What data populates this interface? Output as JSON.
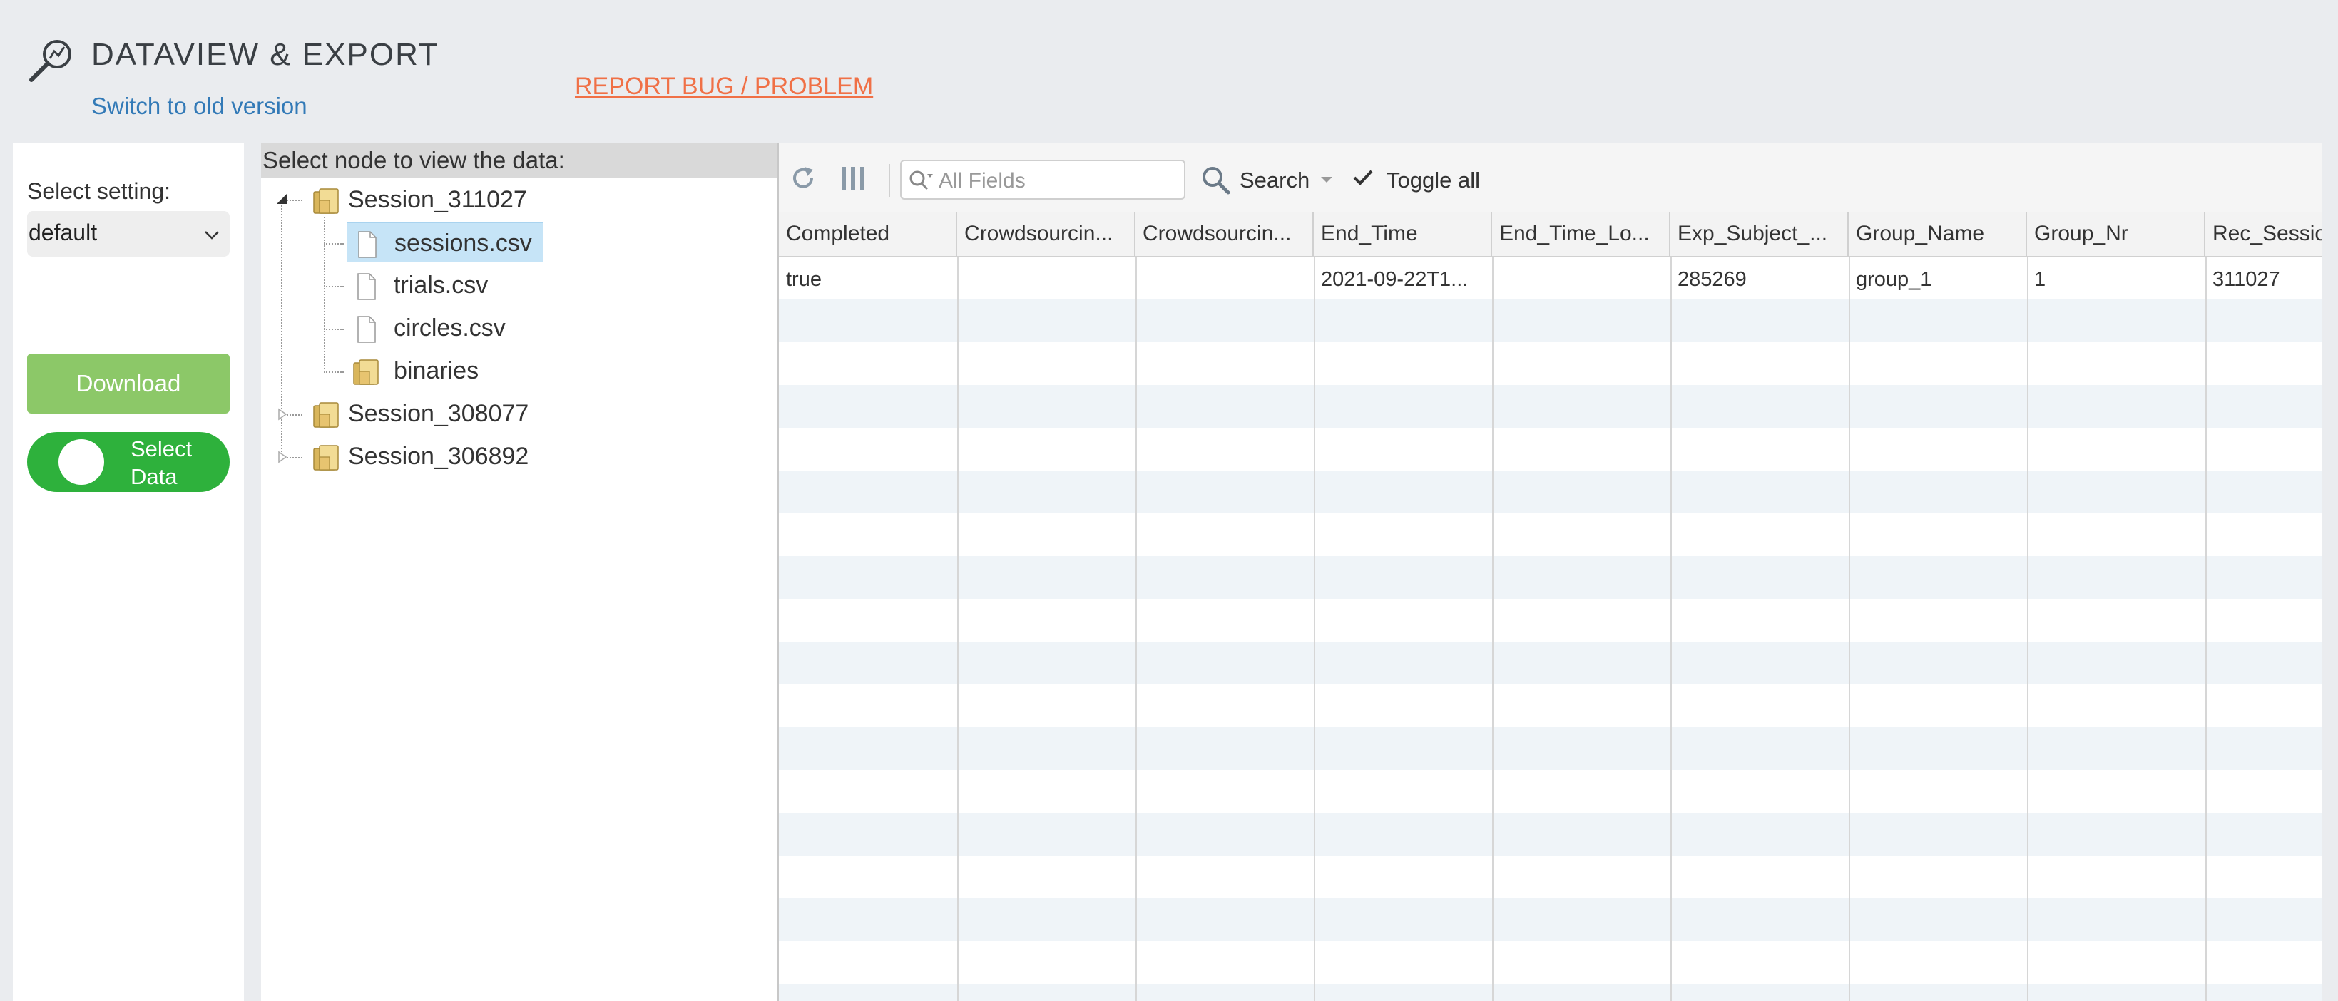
{
  "header": {
    "title": "DATAVIEW & EXPORT",
    "switch_link": "Switch to old version",
    "report_link": "REPORT BUG / PROBLEM"
  },
  "settings": {
    "label": "Select setting:",
    "selected": "default",
    "download_label": "Download",
    "select_data_label": "Select Data"
  },
  "tree": {
    "header": "Select node to view the data:",
    "nodes": [
      {
        "label": "Session_311027",
        "type": "folder",
        "expanded": true
      },
      {
        "label": "sessions.csv",
        "type": "file",
        "selected": true
      },
      {
        "label": "trials.csv",
        "type": "file"
      },
      {
        "label": "circles.csv",
        "type": "file"
      },
      {
        "label": "binaries",
        "type": "folder"
      },
      {
        "label": "Session_308077",
        "type": "folder"
      },
      {
        "label": "Session_306892",
        "type": "folder"
      }
    ]
  },
  "toolbar": {
    "search_placeholder": "All Fields",
    "search_label": "Search",
    "toggle_all_label": "Toggle all"
  },
  "grid": {
    "columns": [
      "Completed",
      "Crowdsourcin...",
      "Crowdsourcin...",
      "End_Time",
      "End_Time_Lo...",
      "Exp_Subject_...",
      "Group_Name",
      "Group_Nr",
      "Rec_Sessio"
    ],
    "rows": [
      [
        "true",
        "",
        "",
        "2021-09-22T1...",
        "",
        "285269",
        "group_1",
        "1",
        "311027"
      ]
    ]
  },
  "colors": {
    "link": "#337ab7",
    "report": "#f07046",
    "download": "#8cc868",
    "toggle": "#2eb13c",
    "selected_node": "#c6e4f7"
  }
}
